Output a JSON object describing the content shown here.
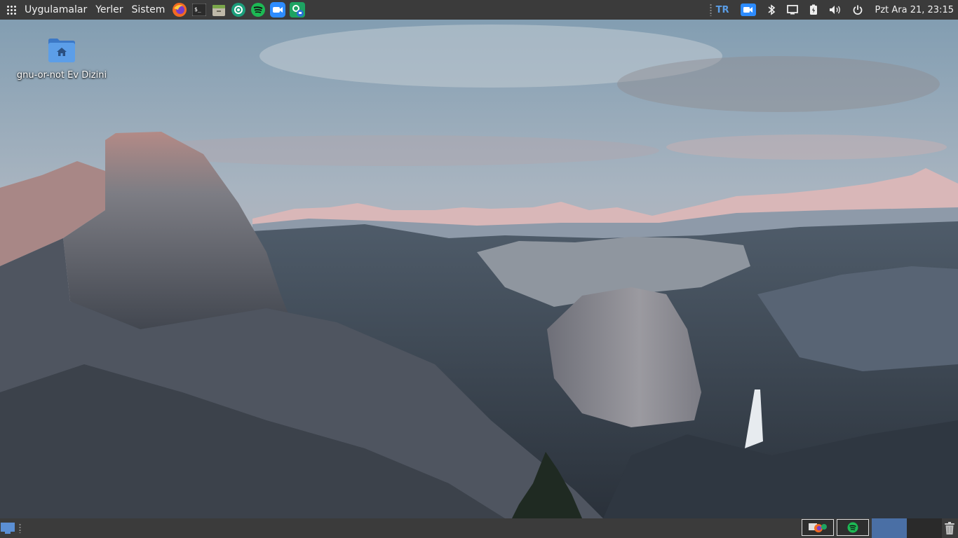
{
  "top_panel": {
    "apps_icon": "apps-grid-icon",
    "menus": [
      "Uygulamalar",
      "Yerler",
      "Sistem"
    ],
    "launchers": [
      "firefox-icon",
      "terminal-icon",
      "files-icon",
      "browser-icon",
      "spotify-icon",
      "zoom-icon",
      "chat-icon"
    ],
    "tray": {
      "keyboard_layout": "TR",
      "clock": "Pzt Ara 21, 23:15",
      "icons": [
        "zoom-tray-icon",
        "bluetooth-icon",
        "display-icon",
        "battery-icon",
        "volume-icon",
        "power-icon"
      ]
    }
  },
  "desktop": {
    "icons": [
      {
        "label": "gnu-or-not Ev Dizini",
        "icon": "home-folder-icon"
      }
    ]
  },
  "bottom_panel": {
    "windows": [
      "firefox-window",
      "spotify-window"
    ],
    "workspaces": 2,
    "active_workspace": 1
  },
  "colors": {
    "panel_bg": "#3b3b3b",
    "accent": "#4a6fa5",
    "keyboard_layout": "#5a9de6"
  }
}
